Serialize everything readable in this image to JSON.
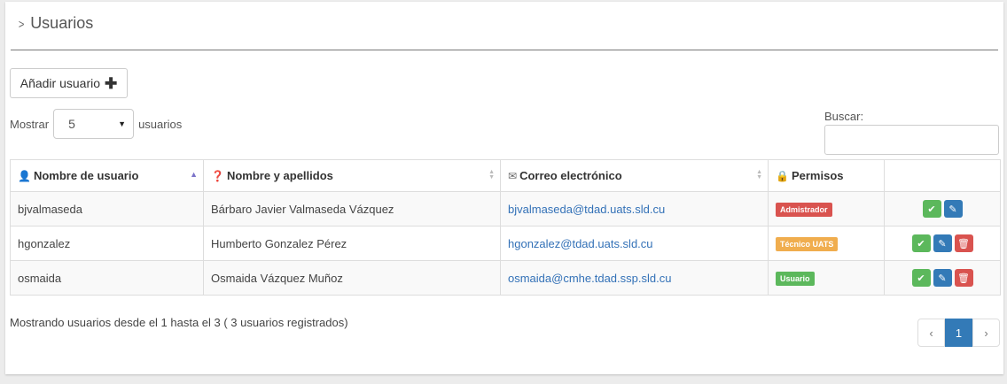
{
  "header": {
    "title": "Usuarios"
  },
  "toolbar": {
    "add_label": "Añadir usuario"
  },
  "length": {
    "prefix": "Mostrar",
    "value": "5",
    "suffix": "usuarios"
  },
  "search": {
    "label": "Buscar:"
  },
  "table": {
    "columns": [
      "Nombre de usuario",
      "Nombre y apellidos",
      "Correo electrónico",
      "Permisos"
    ],
    "rows": [
      {
        "username": "bjvalmaseda",
        "fullname": "Bárbaro Javier Valmaseda Vázquez",
        "email": "bjvalmaseda@tdad.uats.sld.cu",
        "role": "Admistrador",
        "role_color": "#d9534f",
        "actions": [
          "check",
          "edit"
        ]
      },
      {
        "username": "hgonzalez",
        "fullname": "Humberto Gonzalez Pérez",
        "email": "hgonzalez@tdad.uats.sld.cu",
        "role": "Técnico UATS",
        "role_color": "#f0ad4e",
        "actions": [
          "check",
          "edit",
          "delete"
        ]
      },
      {
        "username": "osmaida",
        "fullname": "Osmaida Vázquez Muñoz",
        "email": "osmaida@cmhe.tdad.ssp.sld.cu",
        "role": "Usuario",
        "role_color": "#5cb85c",
        "actions": [
          "check",
          "edit",
          "delete"
        ]
      }
    ]
  },
  "footer": {
    "info": "Mostrando usuarios desde el 1 hasta el 3 ( 3 usuarios registrados)"
  },
  "pagination": {
    "prev": "‹",
    "current": "1",
    "next": "›"
  },
  "colors": {
    "primary": "#337ab7",
    "success": "#5cb85c",
    "danger": "#d9534f",
    "warning": "#f0ad4e"
  }
}
